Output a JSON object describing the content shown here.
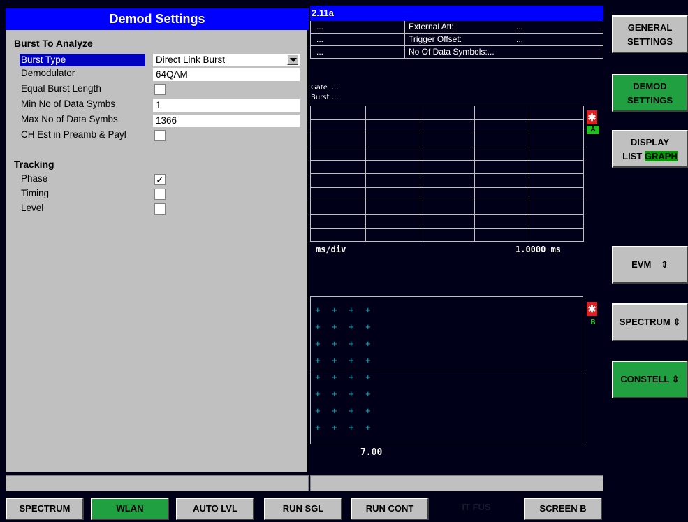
{
  "dialog": {
    "title": "Demod Settings",
    "burst_section": "Burst To Analyze",
    "rows": [
      {
        "label": "Burst Type",
        "value": "Direct Link Burst"
      },
      {
        "label": "Demodulator",
        "value": "64QAM"
      },
      {
        "label": "Equal Burst Length",
        "checked": false
      },
      {
        "label": "Min No of Data Symbs",
        "value": "1"
      },
      {
        "label": "Max No of Data Symbs",
        "value": "1366"
      },
      {
        "label": "CH Est in Preamb & Payl",
        "checked": false
      }
    ],
    "tracking_section": "Tracking",
    "tracking": [
      {
        "label": "Phase",
        "check": "✓"
      },
      {
        "label": "Timing",
        "check": ""
      },
      {
        "label": "Level",
        "check": ""
      }
    ]
  },
  "screen": {
    "title": "2.11a",
    "rows": [
      {
        "left": "...",
        "label": "External Att:",
        "value": "..."
      },
      {
        "left": "...",
        "label": "Trigger Offset:",
        "value": "..."
      },
      {
        "left": "...",
        "label": "No Of Data Symbols:..."
      }
    ],
    "gate_label": "Gate",
    "gate_value": "...",
    "burst_label": "Burst",
    "burst_value": "...",
    "axis_left": "ms/div",
    "axis_right": "1.0000  ms",
    "trace_a": "A",
    "trace_b": "B",
    "scale_b": "7.00"
  },
  "softkeys": {
    "general_1": "GENERAL",
    "general_2": "SETTINGS",
    "demod_1": "DEMOD",
    "demod_2": "SETTINGS",
    "display_1": "DISPLAY",
    "display_list": "LIST",
    "display_graph": "GRAPH",
    "evm": "EVM",
    "spectrum": "SPECTRUM",
    "constell": "CONSTELL",
    "arrow": "⇕",
    "accent_green": "#20a040"
  },
  "hotkeys": [
    "SPECTRUM",
    "WLAN",
    "AUTO LVL",
    "RUN SGL",
    "RUN CONT",
    "IT FUS",
    "SCREEN B"
  ]
}
